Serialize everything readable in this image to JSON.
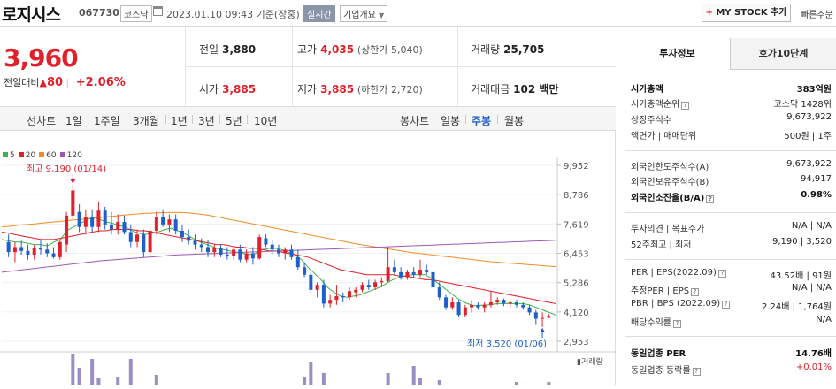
{
  "header": {
    "stock_name": "로지시스",
    "stock_code": "067730",
    "market": "코스닥",
    "datetime": "2023.01.10 09:43 기준(장중)",
    "realtime": "실시간",
    "company_overview": "기업개요",
    "my_stock_button": "MY STOCK 추가",
    "my_stock_plus": "+",
    "quick_link": "빠른주문"
  },
  "price": {
    "current": "3,960",
    "change_label": "전일대비",
    "change_arrow": "▲",
    "change_value": "80",
    "change_rate": "+2.06%"
  },
  "stats": {
    "prev_close_label": "전일",
    "prev_close": "3,880",
    "high_label": "고가",
    "high": "4,035",
    "upper_limit": "(상한가 5,040)",
    "volume_label": "거래량",
    "volume": "25,705",
    "open_label": "시가",
    "open": "3,885",
    "low_label": "저가",
    "low": "3,885",
    "lower_limit": "(하한가 2,720)",
    "amount_label": "거래대금",
    "amount": "102 백만"
  },
  "chart_tabs": {
    "line_label": "선차트",
    "line_periods": [
      "1일",
      "1주일",
      "3개월",
      "1년",
      "3년",
      "5년",
      "10년"
    ],
    "candle_label": "봉차트",
    "candle_periods": [
      "일봉",
      "주봉",
      "월봉"
    ],
    "active_candle": "주봉"
  },
  "legend": [
    {
      "label": "5",
      "color": "#3cb44b"
    },
    {
      "label": "20",
      "color": "#e0212b"
    },
    {
      "label": "60",
      "color": "#f28c28"
    },
    {
      "label": "120",
      "color": "#9b59b6"
    }
  ],
  "chart_data": {
    "type": "candlestick",
    "y_ticks": [
      "9,952",
      "8,786",
      "7,619",
      "6,453",
      "5,286",
      "4,120",
      "2,953"
    ],
    "ylim": [
      2953,
      9952
    ],
    "max_label": "최고 9,190 (01/14)",
    "min_label": "최저 3,520 (01/06)",
    "volume_label": "거래량",
    "up_color": "#e0212b",
    "down_color": "#1e5fc8",
    "candles": [
      {
        "o": 6900,
        "h": 7200,
        "l": 6300,
        "c": 6500
      },
      {
        "o": 6500,
        "h": 6900,
        "l": 6100,
        "c": 6700
      },
      {
        "o": 6700,
        "h": 6950,
        "l": 6400,
        "c": 6550
      },
      {
        "o": 6550,
        "h": 6800,
        "l": 6200,
        "c": 6400
      },
      {
        "o": 6400,
        "h": 6800,
        "l": 6200,
        "c": 6650
      },
      {
        "o": 6650,
        "h": 7000,
        "l": 6400,
        "c": 6600
      },
      {
        "o": 6600,
        "h": 6850,
        "l": 6300,
        "c": 6450
      },
      {
        "o": 6450,
        "h": 6700,
        "l": 6250,
        "c": 6300
      },
      {
        "o": 6300,
        "h": 7000,
        "l": 6200,
        "c": 6900
      },
      {
        "o": 6800,
        "h": 8100,
        "l": 6500,
        "c": 7950
      },
      {
        "o": 7950,
        "h": 9190,
        "l": 7800,
        "c": 8950
      },
      {
        "o": 8100,
        "h": 8400,
        "l": 7300,
        "c": 7500
      },
      {
        "o": 7500,
        "h": 8200,
        "l": 7200,
        "c": 7900
      },
      {
        "o": 7900,
        "h": 8200,
        "l": 7300,
        "c": 7500
      },
      {
        "o": 7500,
        "h": 8500,
        "l": 7300,
        "c": 8150
      },
      {
        "o": 8150,
        "h": 8300,
        "l": 7400,
        "c": 7600
      },
      {
        "o": 7600,
        "h": 8100,
        "l": 7200,
        "c": 7400
      },
      {
        "o": 7400,
        "h": 8000,
        "l": 7200,
        "c": 7700
      },
      {
        "o": 7700,
        "h": 7950,
        "l": 7200,
        "c": 7300
      },
      {
        "o": 7300,
        "h": 7600,
        "l": 6700,
        "c": 6900
      },
      {
        "o": 6900,
        "h": 7400,
        "l": 6700,
        "c": 7200
      },
      {
        "o": 7200,
        "h": 7400,
        "l": 6300,
        "c": 6500
      },
      {
        "o": 6500,
        "h": 7500,
        "l": 6400,
        "c": 7350
      },
      {
        "o": 7350,
        "h": 8100,
        "l": 7200,
        "c": 7900
      },
      {
        "o": 7900,
        "h": 8200,
        "l": 7500,
        "c": 7600
      },
      {
        "o": 7600,
        "h": 8000,
        "l": 7300,
        "c": 7800
      },
      {
        "o": 7800,
        "h": 8000,
        "l": 7200,
        "c": 7350
      },
      {
        "o": 7350,
        "h": 7600,
        "l": 6900,
        "c": 7100
      },
      {
        "o": 7100,
        "h": 7400,
        "l": 6800,
        "c": 6950
      },
      {
        "o": 6950,
        "h": 7200,
        "l": 6600,
        "c": 6800
      },
      {
        "o": 6800,
        "h": 7050,
        "l": 6500,
        "c": 6700
      },
      {
        "o": 6700,
        "h": 7000,
        "l": 6300,
        "c": 6500
      },
      {
        "o": 6500,
        "h": 6800,
        "l": 6300,
        "c": 6650
      },
      {
        "o": 6650,
        "h": 6800,
        "l": 6300,
        "c": 6400
      },
      {
        "o": 6400,
        "h": 6700,
        "l": 6200,
        "c": 6350
      },
      {
        "o": 6350,
        "h": 6700,
        "l": 6200,
        "c": 6600
      },
      {
        "o": 6600,
        "h": 6800,
        "l": 6100,
        "c": 6200
      },
      {
        "o": 6200,
        "h": 6600,
        "l": 6100,
        "c": 6450
      },
      {
        "o": 6450,
        "h": 6700,
        "l": 6000,
        "c": 6250
      },
      {
        "o": 6250,
        "h": 7200,
        "l": 6200,
        "c": 7100
      },
      {
        "o": 7050,
        "h": 7200,
        "l": 6700,
        "c": 6800
      },
      {
        "o": 6800,
        "h": 7000,
        "l": 6400,
        "c": 6600
      },
      {
        "o": 6600,
        "h": 6800,
        "l": 6300,
        "c": 6450
      },
      {
        "o": 6450,
        "h": 6700,
        "l": 6200,
        "c": 6600
      },
      {
        "o": 6600,
        "h": 6800,
        "l": 6200,
        "c": 6300
      },
      {
        "o": 6300,
        "h": 6600,
        "l": 5800,
        "c": 5900
      },
      {
        "o": 5900,
        "h": 6100,
        "l": 5500,
        "c": 5600
      },
      {
        "o": 5600,
        "h": 5700,
        "l": 4800,
        "c": 5000
      },
      {
        "o": 5000,
        "h": 5300,
        "l": 4700,
        "c": 5200
      },
      {
        "o": 5200,
        "h": 5400,
        "l": 4300,
        "c": 4450
      },
      {
        "o": 4450,
        "h": 4800,
        "l": 4300,
        "c": 4600
      },
      {
        "o": 4600,
        "h": 5200,
        "l": 4400,
        "c": 4750
      },
      {
        "o": 4750,
        "h": 4900,
        "l": 4500,
        "c": 4700
      },
      {
        "o": 4700,
        "h": 5100,
        "l": 4600,
        "c": 4950
      },
      {
        "o": 4900,
        "h": 5100,
        "l": 4700,
        "c": 5000
      },
      {
        "o": 5000,
        "h": 5300,
        "l": 4900,
        "c": 5200
      },
      {
        "o": 5200,
        "h": 5400,
        "l": 5000,
        "c": 5100
      },
      {
        "o": 5100,
        "h": 5400,
        "l": 5000,
        "c": 5300
      },
      {
        "o": 5300,
        "h": 5500,
        "l": 5100,
        "c": 5350
      },
      {
        "o": 5350,
        "h": 6700,
        "l": 5300,
        "c": 5900
      },
      {
        "o": 5900,
        "h": 6200,
        "l": 5600,
        "c": 5700
      },
      {
        "o": 5700,
        "h": 5900,
        "l": 5400,
        "c": 5500
      },
      {
        "o": 5500,
        "h": 5800,
        "l": 5400,
        "c": 5700
      },
      {
        "o": 5700,
        "h": 5900,
        "l": 5500,
        "c": 5600
      },
      {
        "o": 5600,
        "h": 6200,
        "l": 5500,
        "c": 5800
      },
      {
        "o": 5800,
        "h": 6000,
        "l": 5600,
        "c": 5700
      },
      {
        "o": 5700,
        "h": 5900,
        "l": 5000,
        "c": 5100
      },
      {
        "o": 5100,
        "h": 5300,
        "l": 4600,
        "c": 4700
      },
      {
        "o": 4700,
        "h": 4800,
        "l": 4200,
        "c": 4300
      },
      {
        "o": 4300,
        "h": 4700,
        "l": 4200,
        "c": 4500
      },
      {
        "o": 4500,
        "h": 4600,
        "l": 3900,
        "c": 4000
      },
      {
        "o": 4000,
        "h": 4400,
        "l": 3900,
        "c": 4300
      },
      {
        "o": 4300,
        "h": 4600,
        "l": 4100,
        "c": 4400
      },
      {
        "o": 4400,
        "h": 4500,
        "l": 4200,
        "c": 4300
      },
      {
        "o": 4300,
        "h": 4500,
        "l": 4100,
        "c": 4400
      },
      {
        "o": 4400,
        "h": 4950,
        "l": 4300,
        "c": 4500
      },
      {
        "o": 4500,
        "h": 4700,
        "l": 4400,
        "c": 4600
      },
      {
        "o": 4600,
        "h": 4650,
        "l": 4350,
        "c": 4450
      },
      {
        "o": 4450,
        "h": 4600,
        "l": 4300,
        "c": 4500
      },
      {
        "o": 4500,
        "h": 4600,
        "l": 4300,
        "c": 4400
      },
      {
        "o": 4400,
        "h": 4500,
        "l": 4200,
        "c": 4300
      },
      {
        "o": 4300,
        "h": 4400,
        "l": 4000,
        "c": 4100
      },
      {
        "o": 4100,
        "h": 4200,
        "l": 3600,
        "c": 3850
      },
      {
        "o": 3850,
        "h": 4100,
        "l": 3520,
        "c": 3880
      },
      {
        "o": 3885,
        "h": 4035,
        "l": 3885,
        "c": 3960
      }
    ],
    "volumes": [
      0,
      0,
      0,
      0,
      0,
      0,
      0,
      0,
      0,
      0,
      36,
      20,
      0,
      30,
      8,
      0,
      0,
      10,
      0,
      30,
      0,
      0,
      0,
      12,
      0,
      0,
      0,
      0,
      0,
      0,
      0,
      0,
      0,
      0,
      0,
      0,
      0,
      0,
      0,
      0,
      0,
      0,
      0,
      0,
      0,
      0,
      10,
      26,
      0,
      14,
      0,
      0,
      0,
      0,
      0,
      0,
      0,
      0,
      0,
      14,
      0,
      0,
      0,
      22,
      8,
      0,
      0,
      6,
      0,
      0,
      0,
      0,
      0,
      0,
      0,
      0,
      0,
      0,
      0,
      4,
      0,
      0,
      0,
      0,
      4
    ],
    "ma_lines": {
      "ma5": [
        7000,
        6950,
        6900,
        6900,
        6850,
        6800,
        6800,
        6750,
        6900,
        7000,
        7350,
        7500,
        7650,
        7750,
        7900,
        7800,
        7700,
        7650,
        7550,
        7500,
        7350,
        7250,
        7200,
        7250,
        7300,
        7400,
        7450,
        7350,
        7250,
        7100,
        6950,
        6850,
        6750,
        6650,
        6600,
        6550,
        6500,
        6450,
        6400,
        6450,
        6600,
        6650,
        6650,
        6600,
        6500,
        6400,
        6200,
        5900,
        5650,
        5400,
        5100,
        4900,
        4750,
        4700,
        4750,
        4800,
        4900,
        5000,
        5100,
        5250,
        5400,
        5500,
        5550,
        5600,
        5600,
        5600,
        5450,
        5250,
        5050,
        4850,
        4650,
        4500,
        4400,
        4350,
        4400,
        4400,
        4450,
        4450,
        4450,
        4450,
        4450,
        4400,
        4300,
        4200,
        4100,
        4000
      ],
      "ma20": [
        7300,
        7250,
        7200,
        7150,
        7100,
        7050,
        7000,
        7000,
        7000,
        7050,
        7100,
        7150,
        7200,
        7250,
        7300,
        7350,
        7350,
        7400,
        7400,
        7400,
        7400,
        7350,
        7350,
        7300,
        7250,
        7200,
        7150,
        7100,
        7050,
        7000,
        6950,
        6900,
        6850,
        6800,
        6800,
        6750,
        6700,
        6700,
        6650,
        6650,
        6600,
        6550,
        6550,
        6500,
        6450,
        6400,
        6350,
        6300,
        6200,
        6100,
        6000,
        5900,
        5800,
        5750,
        5700,
        5650,
        5600,
        5600,
        5600,
        5600,
        5600,
        5550,
        5550,
        5500,
        5450,
        5400,
        5400,
        5350,
        5300,
        5250,
        5200,
        5150,
        5100,
        5050,
        5000,
        4950,
        4900,
        4850,
        4800,
        4750,
        4700,
        4650,
        4600,
        4550,
        4500,
        4450
      ],
      "ma60": [
        7500,
        7520,
        7550,
        7580,
        7600,
        7620,
        7650,
        7680,
        7700,
        7720,
        7750,
        7780,
        7800,
        7820,
        7850,
        7870,
        7900,
        7920,
        7950,
        7980,
        8000,
        8020,
        8040,
        8050,
        8060,
        8070,
        8080,
        8080,
        8070,
        8050,
        8020,
        7990,
        7950,
        7900,
        7850,
        7800,
        7750,
        7700,
        7650,
        7600,
        7550,
        7500,
        7450,
        7400,
        7350,
        7300,
        7250,
        7200,
        7150,
        7100,
        7050,
        7000,
        6950,
        6900,
        6850,
        6800,
        6760,
        6720,
        6680,
        6640,
        6600,
        6560,
        6520,
        6480,
        6450,
        6420,
        6390,
        6360,
        6330,
        6300,
        6270,
        6240,
        6210,
        6180,
        6150,
        6120,
        6100,
        6080,
        6060,
        6040,
        6020,
        6000,
        5980,
        5960,
        5940,
        5920
      ],
      "ma120": [
        5700,
        5730,
        5760,
        5790,
        5820,
        5850,
        5880,
        5910,
        5940,
        5970,
        6000,
        6030,
        6060,
        6090,
        6120,
        6150,
        6170,
        6190,
        6210,
        6230,
        6250,
        6270,
        6290,
        6310,
        6330,
        6350,
        6370,
        6390,
        6400,
        6410,
        6420,
        6430,
        6440,
        6450,
        6460,
        6470,
        6480,
        6490,
        6500,
        6510,
        6520,
        6530,
        6540,
        6550,
        6560,
        6570,
        6580,
        6590,
        6600,
        6610,
        6620,
        6630,
        6640,
        6650,
        6660,
        6670,
        6680,
        6690,
        6700,
        6710,
        6720,
        6730,
        6740,
        6750,
        6760,
        6770,
        6780,
        6790,
        6800,
        6810,
        6820,
        6830,
        6840,
        6850,
        6860,
        6870,
        6880,
        6890,
        6900,
        6910,
        6920,
        6930,
        6940,
        6950,
        6960,
        6970
      ]
    }
  },
  "side_panel": {
    "tabs": [
      "투자정보",
      "호가10단계"
    ],
    "rows": [
      {
        "k": "시가총액",
        "v": "383억원",
        "bold": true
      },
      {
        "k": "시가총액순위",
        "v": "코스닥 1428위",
        "q": true
      },
      {
        "k": "상장주식수",
        "v": "9,673,922"
      },
      {
        "k": "액면가 | 매매단위",
        "v": "500원 | 1주"
      },
      {
        "k": "외국인한도주식수(A)",
        "v": "9,673,922"
      },
      {
        "k": "외국인보유주식수(B)",
        "v": "94,917"
      },
      {
        "k": "외국인소진율(B/A)",
        "v": "0.98%",
        "bold": true,
        "q": true
      },
      {
        "k": "투자의견 | 목표주가",
        "v": "N/A | N/A"
      },
      {
        "k": "52주최고 | 최저",
        "v": "9,190 | 3,520"
      },
      {
        "k": "PER | EPS(2022.09)",
        "v": "43.52배 | 91원",
        "q": true
      },
      {
        "k": "추정PER | EPS",
        "v": "N/A | N/A",
        "q": true
      },
      {
        "k": "PBR | BPS (2022.09)",
        "v": "2.24배 | 1,764원",
        "q": true
      },
      {
        "k": "배당수익률",
        "v": "N/A",
        "q": true
      },
      {
        "k": "동일업종 PER",
        "v": "14.76배",
        "bold": true
      },
      {
        "k": "동일업종 등락률",
        "v": "+0.01%",
        "red": true,
        "q": true
      }
    ]
  }
}
